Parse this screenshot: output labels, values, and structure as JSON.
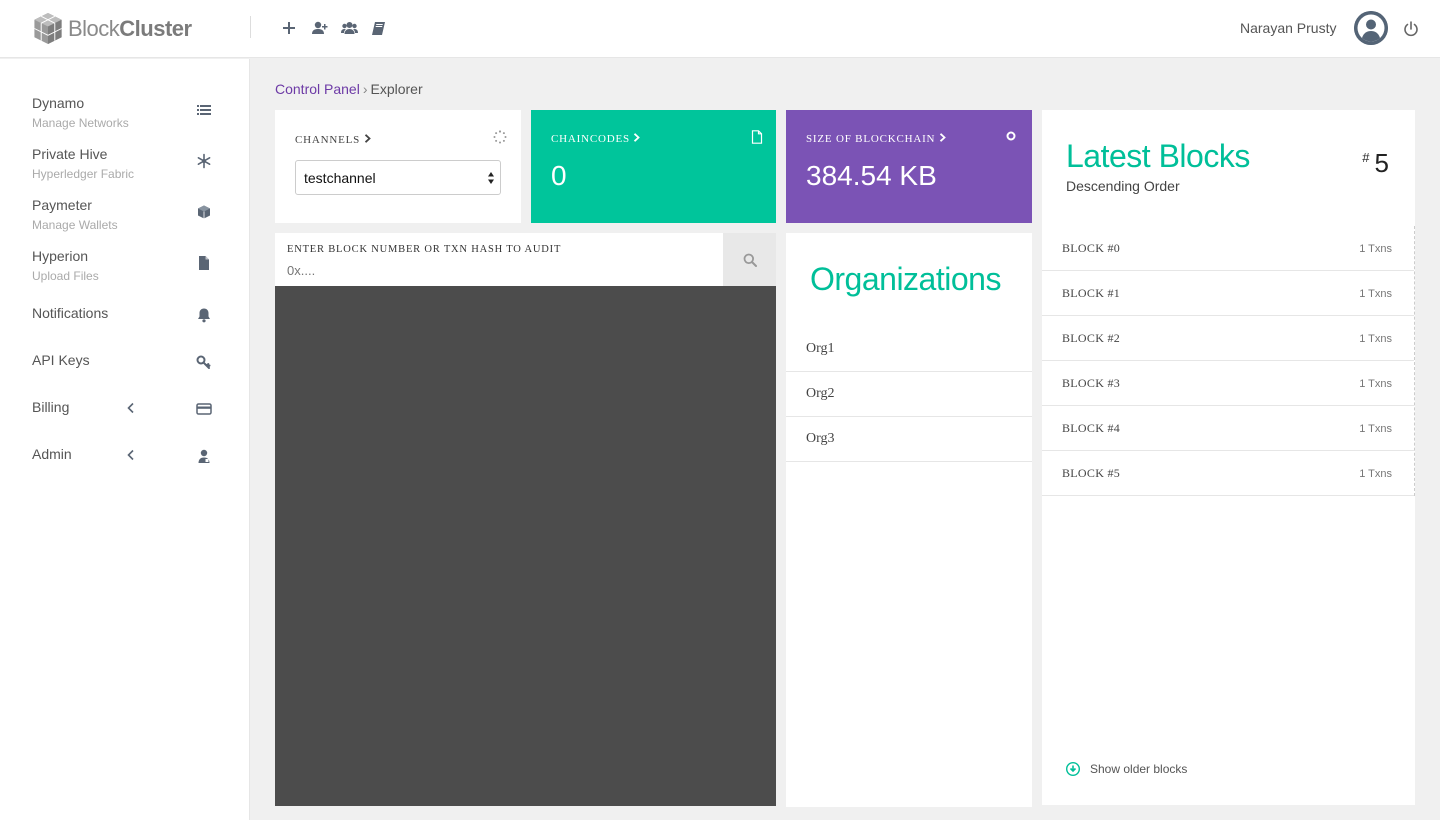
{
  "brand": {
    "name_light": "Block",
    "name_bold": "Cluster"
  },
  "user": {
    "name": "Narayan Prusty"
  },
  "top_actions": [
    "plus-icon",
    "add-user-icon",
    "users-icon",
    "book-icon"
  ],
  "sidebar": {
    "items": [
      {
        "title": "Dynamo",
        "sub": "Manage Networks",
        "icon": "list-icon"
      },
      {
        "title": "Private Hive",
        "sub": "Hyperledger Fabric",
        "icon": "snowflake-icon"
      },
      {
        "title": "Paymeter",
        "sub": "Manage Wallets",
        "icon": "cube-icon"
      },
      {
        "title": "Hyperion",
        "sub": "Upload Files",
        "icon": "file-icon"
      },
      {
        "title": "Notifications",
        "icon": "bell-icon"
      },
      {
        "title": "API Keys",
        "icon": "key-icon"
      },
      {
        "title": "Billing",
        "icon": "credit-card-icon"
      },
      {
        "title": "Admin",
        "icon": "admin-user-icon"
      }
    ]
  },
  "breadcrumb": {
    "root": "Control Panel",
    "current": "Explorer"
  },
  "channels": {
    "label": "Channels",
    "selected": "testchannel"
  },
  "chaincodes": {
    "label": "Chaincodes",
    "value": "0"
  },
  "blockchain_size": {
    "label": "Size of Blockchain",
    "value": "384.54 KB"
  },
  "audit": {
    "label": "Enter block number or txn hash to audit",
    "placeholder": "0x...."
  },
  "organizations": {
    "title": "Organizations",
    "items": [
      "Org1",
      "Org2",
      "Org3"
    ]
  },
  "latest_blocks": {
    "title": "Latest Blocks",
    "subtitle": "Descending Order",
    "count_prefix": "#",
    "count": "5",
    "items": [
      {
        "name": "BLOCK #0",
        "txns": "1 Txns"
      },
      {
        "name": "BLOCK #1",
        "txns": "1 Txns"
      },
      {
        "name": "BLOCK #2",
        "txns": "1 Txns"
      },
      {
        "name": "BLOCK #3",
        "txns": "1 Txns"
      },
      {
        "name": "BLOCK #4",
        "txns": "1 Txns"
      },
      {
        "name": "BLOCK #5",
        "txns": "1 Txns"
      }
    ],
    "older_label": "Show older blocks"
  },
  "colors": {
    "accent": "#00c59b",
    "purple": "#7b53b5",
    "link": "#6d3aa6",
    "dark_panel": "#4c4c4c"
  }
}
